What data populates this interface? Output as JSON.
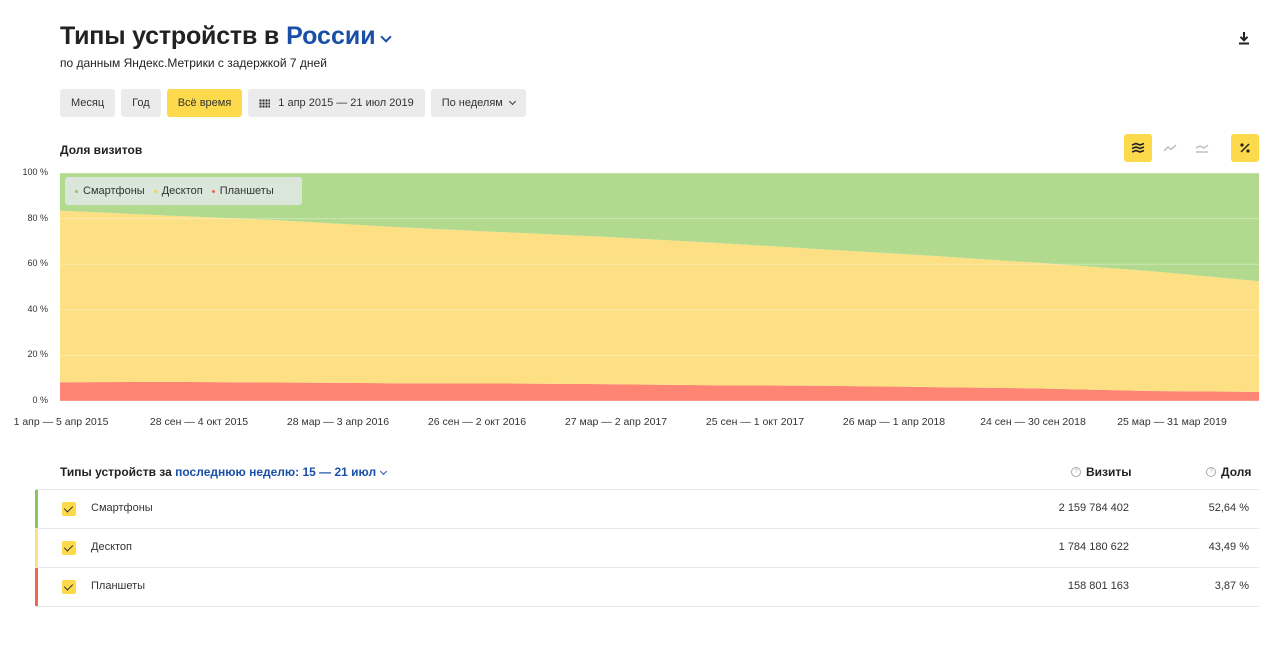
{
  "header": {
    "title": "Типы устройств в",
    "region": "России",
    "subtitle": "по данным Яндекс.Метрики с задержкой 7 дней"
  },
  "toolbar": {
    "month": "Месяц",
    "year": "Год",
    "all_time": "Всё время",
    "date_range": "1 апр 2015 — 21 июл 2019",
    "grouping": "По неделям"
  },
  "chart_title": "Доля визитов",
  "chart_data": {
    "type": "area",
    "stacked": true,
    "normalized": true,
    "ylabel": "",
    "xlabel": "",
    "ylim": [
      0,
      100
    ],
    "y_ticks": [
      "0 %",
      "20 %",
      "40 %",
      "60 %",
      "80 %",
      "100 %"
    ],
    "x_ticks": [
      "1 апр — 5 апр 2015",
      "28 сен — 4 окт 2015",
      "28 мар — 3 апр 2016",
      "26 сен — 2 окт 2016",
      "27 мар — 2 апр 2017",
      "25 сен — 1 окт 2017",
      "26 мар — 1 апр 2018",
      "24 сен — 30 сен 2018",
      "25 мар — 31 мар 2019"
    ],
    "grid": true,
    "legend_position": "top-left",
    "series": [
      {
        "name": "Смартфоны",
        "color": "#b1da8f",
        "values": [
          16.5,
          18.7,
          20.7,
          23.5,
          25.8,
          28.0,
          30.6,
          33.5,
          36.3,
          39.5,
          43.0,
          47.5
        ]
      },
      {
        "name": "Десктоп",
        "color": "#fce083",
        "values": [
          75.3,
          72.9,
          71.2,
          68.7,
          66.5,
          64.6,
          62.5,
          59.8,
          57.6,
          55.0,
          52.6,
          48.5
        ]
      },
      {
        "name": "Планшеты",
        "color": "#fe8573",
        "values": [
          8.2,
          8.4,
          8.1,
          7.8,
          7.7,
          7.4,
          6.9,
          6.7,
          6.1,
          5.5,
          4.4,
          4.0
        ]
      }
    ]
  },
  "table": {
    "label": "Типы устройств за",
    "period": "последнюю неделю: 15 — 21 июл",
    "col_visits": "Визиты",
    "col_share": "Доля",
    "help": "?",
    "rows": [
      {
        "name": "Смартфоны",
        "visits": "2 159 784 402",
        "share": "52,64 %",
        "color": "#8cc660"
      },
      {
        "name": "Десктоп",
        "visits": "1 784 180 622",
        "share": "43,49 %",
        "color": "#fce083"
      },
      {
        "name": "Планшеты",
        "visits": "158 801 163",
        "share": "3,87 %",
        "color": "#ed6a52"
      }
    ]
  }
}
